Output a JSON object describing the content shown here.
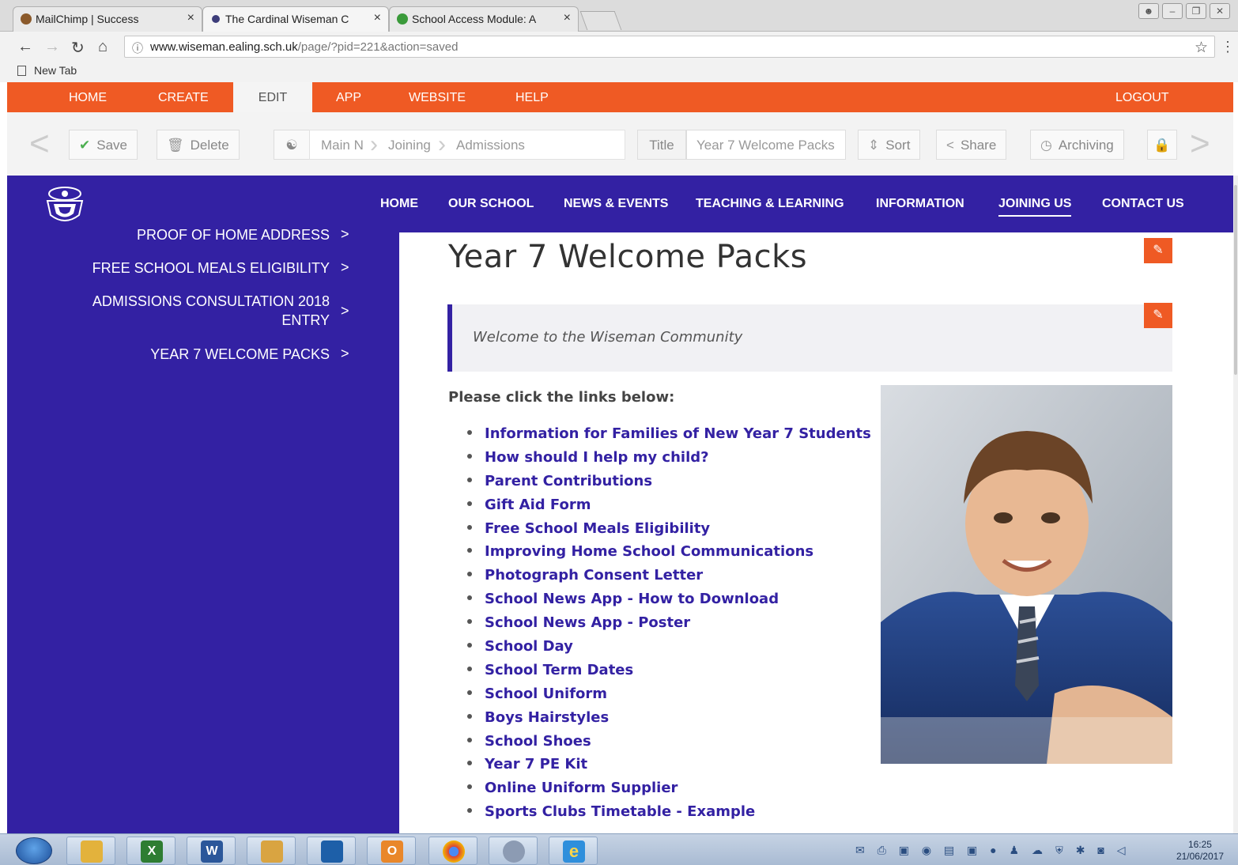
{
  "browser": {
    "tabs": [
      {
        "title": "MailChimp | Success"
      },
      {
        "title": "The Cardinal Wiseman C"
      },
      {
        "title": "School Access Module: A"
      }
    ],
    "url_host": "www.wiseman.ealing.sch.uk",
    "url_path": "/page/?pid=221&action=saved",
    "bookmark": "New Tab"
  },
  "cms": {
    "menu": [
      "HOME",
      "CREATE",
      "EDIT",
      "APP",
      "WEBSITE",
      "HELP"
    ],
    "logout": "LOGOUT",
    "toolbar": {
      "save": "Save",
      "delete": "Delete",
      "crumbs": [
        "Main N",
        "Joining",
        "Admissions"
      ],
      "title_label": "Title",
      "title_value": "Year 7 Welcome Packs",
      "sort": "Sort",
      "share": "Share",
      "archiving": "Archiving"
    }
  },
  "site": {
    "nav": [
      "HOME",
      "OUR SCHOOL",
      "NEWS & EVENTS",
      "TEACHING & LEARNING",
      "INFORMATION",
      "JOINING US",
      "CONTACT US"
    ],
    "sidebar": [
      "PROOF OF HOME ADDRESS",
      "FREE SCHOOL MEALS ELIGIBILITY",
      "ADMISSIONS CONSULTATION 2018",
      "ENTRY",
      "YEAR 7 WELCOME PACKS"
    ],
    "page_title": "Year 7 Welcome Packs",
    "quote": "Welcome to the Wiseman Community",
    "lead": "Please click the links below:",
    "links": [
      "Information for Families of New Year 7 Students",
      "How should I help my child?",
      "Parent Contributions",
      "Gift Aid Form",
      "Free School Meals Eligibility",
      "Improving Home School Communications",
      "Photograph Consent Letter",
      "School News App - How to Download",
      "School News App - Poster",
      "School Day",
      "School Term Dates",
      "School Uniform",
      "Boys Hairstyles",
      "School Shoes",
      "Year 7 PE Kit",
      "Online Uniform Supplier",
      "Sports Clubs Timetable - Example"
    ]
  },
  "taskbar": {
    "time": "16:25",
    "date": "21/06/2017"
  },
  "colors": {
    "cms_orange": "#ef5a24",
    "site_purple": "#3321a3"
  }
}
